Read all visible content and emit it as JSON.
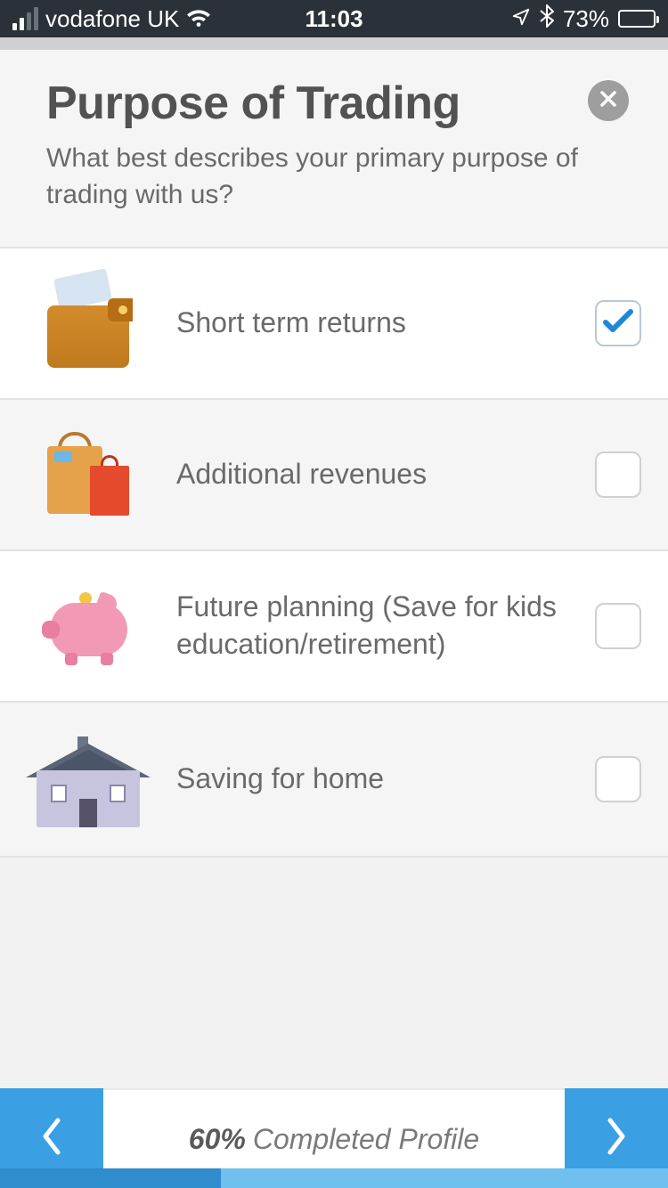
{
  "statusbar": {
    "carrier": "vodafone UK",
    "time": "11:03",
    "battery_pct": "73%",
    "battery_fill": 73
  },
  "header": {
    "title": "Purpose of Trading",
    "subtitle": "What best describes your primary purpose of trading with us?"
  },
  "options": [
    {
      "label": "Short term returns",
      "checked": true,
      "icon": "wallet"
    },
    {
      "label": "Additional revenues",
      "checked": false,
      "icon": "shopping-bags"
    },
    {
      "label": "Future planning (Save for kids education/retirement)",
      "checked": false,
      "icon": "piggy-bank"
    },
    {
      "label": "Saving for home",
      "checked": false,
      "icon": "house"
    }
  ],
  "footer": {
    "percent": "60%",
    "label": "Completed Profile"
  },
  "colors": {
    "accent": "#3a9fe3",
    "text": "#525252"
  }
}
